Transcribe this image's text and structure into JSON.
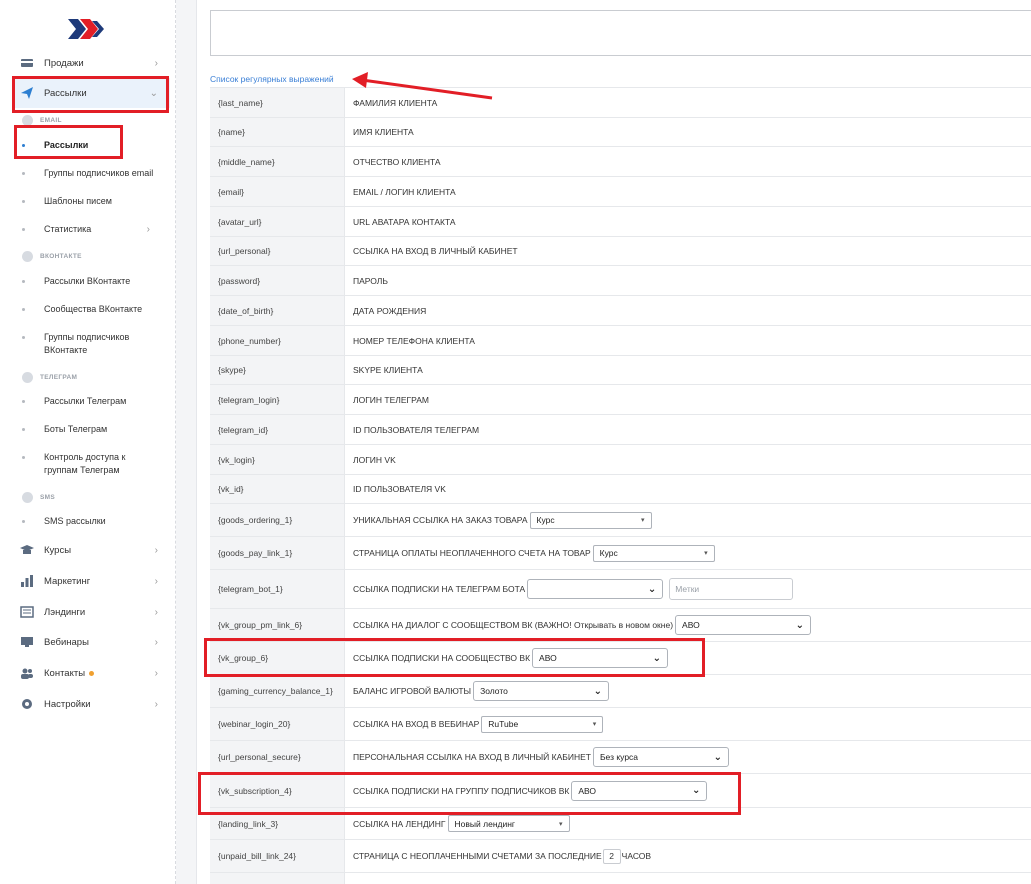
{
  "sidebar": {
    "top_items": [
      {
        "label": "Продажи",
        "icon": "card-icon"
      },
      {
        "label": "Рассылки",
        "icon": "send-icon"
      }
    ],
    "sections": {
      "email": "EMAIL",
      "vk": "ВКОНТАКТЕ",
      "telegram": "ТЕЛЕГРАМ",
      "sms": "SMS"
    },
    "email_items": [
      "Рассылки",
      "Группы подписчиков email",
      "Шаблоны писем",
      "Статистика"
    ],
    "vk_items": [
      "Рассылки ВКонтакте",
      "Сообщества ВКонтакте",
      "Группы подписчиков ВКонтакте"
    ],
    "telegram_items": [
      "Рассылки Телеграм",
      "Боты Телеграм",
      "Контроль доступа к группам Телеграм"
    ],
    "sms_items": [
      "SMS рассылки"
    ],
    "bottom_items": [
      "Курсы",
      "Маркетинг",
      "Лэндинги",
      "Вебинары",
      "Контакты",
      "Настройки"
    ]
  },
  "main": {
    "regex_link": "Список регулярных выражений",
    "rows": [
      {
        "var": "{last_name}",
        "desc": "ФАМИЛИЯ КЛИЕНТА"
      },
      {
        "var": "{name}",
        "desc": "ИМЯ КЛИЕНТА"
      },
      {
        "var": "{middle_name}",
        "desc": "ОТЧЕСТВО КЛИЕНТА"
      },
      {
        "var": "{email}",
        "desc": "EMAIL / ЛОГИН КЛИЕНТА"
      },
      {
        "var": "{avatar_url}",
        "desc": "URL АВАТАРА КОНТАКТА"
      },
      {
        "var": "{url_personal}",
        "desc": "ССЫЛКА НА ВХОД В ЛИЧНЫЙ КАБИНЕТ"
      },
      {
        "var": "{password}",
        "desc": "ПАРОЛЬ"
      },
      {
        "var": "{date_of_birth}",
        "desc": "ДАТА РОЖДЕНИЯ"
      },
      {
        "var": "{phone_number}",
        "desc": "НОМЕР ТЕЛЕФОНА КЛИЕНТА"
      },
      {
        "var": "{skype}",
        "desc": "SKYPE КЛИЕНТА"
      },
      {
        "var": "{telegram_login}",
        "desc": "ЛОГИН ТЕЛЕГРАМ"
      },
      {
        "var": "{telegram_id}",
        "desc": "ID ПОЛЬЗОВАТЕЛЯ ТЕЛЕГРАМ"
      },
      {
        "var": "{vk_login}",
        "desc": "ЛОГИН VK"
      },
      {
        "var": "{vk_id}",
        "desc": "ID ПОЛЬЗОВАТЕЛЯ VK"
      },
      {
        "var": "{goods_ordering_1}",
        "desc": "УНИКАЛЬНАЯ ССЫЛКА НА ЗАКАЗ ТОВАРА",
        "select": "Курс"
      },
      {
        "var": "{goods_pay_link_1}",
        "desc": "СТРАНИЦА ОПЛАТЫ НЕОПЛАЧЕННОГО СЧЕТА НА ТОВАР",
        "select": "Курс"
      },
      {
        "var": "{telegram_bot_1}",
        "desc": "ССЫЛКА ПОДПИСКИ НА ТЕЛЕГРАМ БОТА",
        "select": "",
        "tags_placeholder": "Метки"
      },
      {
        "var": "{vk_group_pm_link_6}",
        "desc": "ССЫЛКА НА ДИАЛОГ С СООБЩЕСТВОМ ВК (ВАЖНО! Открывать в новом окне)",
        "select": "АВО"
      },
      {
        "var": "{vk_group_6}",
        "desc": "ССЫЛКА ПОДПИСКИ НА СООБЩЕСТВО ВК",
        "select": "АВО"
      },
      {
        "var": "{gaming_currency_balance_1}",
        "desc": "БАЛАНС ИГРОВОЙ ВАЛЮТЫ",
        "select": "Золото"
      },
      {
        "var": "{webinar_login_20}",
        "desc": "ССЫЛКА НА ВХОД В ВЕБИНАР",
        "select": "RuTube"
      },
      {
        "var": "{url_personal_secure}",
        "desc": "ПЕРСОНАЛЬНАЯ ССЫЛКА НА ВХОД В ЛИЧНЫЙ КАБИНЕТ",
        "select": "Без курса"
      },
      {
        "var": "{vk_subscription_4}",
        "desc": "ССЫЛКА ПОДПИСКИ НА ГРУППУ ПОДПИСЧИКОВ ВК",
        "select": "АВО"
      },
      {
        "var": "{landing_link_3}",
        "desc": "ССЫЛКА НА ЛЕНДИНГ",
        "select": "Новый лендинг"
      },
      {
        "var": "{unpaid_bill_link_24}",
        "desc": "СТРАНИЦА С НЕОПЛАЧЕННЫМИ СЧЕТАМИ ЗА ПОСЛЕДНИЕ",
        "number": "2",
        "suffix": "ЧАСОВ"
      }
    ]
  },
  "colors": {
    "annotation": "#e21e26",
    "link": "#3a7fd6",
    "active_bg": "#eaf2fb"
  }
}
